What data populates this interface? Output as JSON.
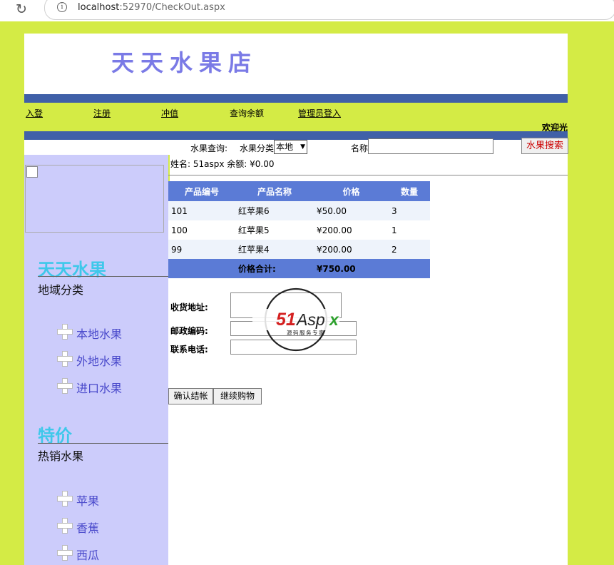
{
  "browser": {
    "url_host": "localhost",
    "url_rest": ":52970/CheckOut.aspx"
  },
  "header": {
    "shop_title": "天天水果店"
  },
  "nav": {
    "login": "入登",
    "register": "注册",
    "recharge": "冲值",
    "balance_query": "查询余额",
    "admin_login": "管理员登入",
    "welcome": "欢迎光"
  },
  "search": {
    "query_label": "水果查询:",
    "category_label": "水果分类",
    "category_value": "本地",
    "name_label": "名称",
    "button": "水果搜索"
  },
  "customer": {
    "info": "姓名: 51aspx     余额: ¥0.00"
  },
  "cart": {
    "headers": [
      "产品编号",
      "产品名称",
      "价格",
      "数量"
    ],
    "rows": [
      {
        "id": "101",
        "name": "红苹果6",
        "price": "¥50.00",
        "qty": "3"
      },
      {
        "id": "100",
        "name": "红苹果5",
        "price": "¥200.00",
        "qty": "1"
      },
      {
        "id": "99",
        "name": "红苹果4",
        "price": "¥200.00",
        "qty": "2"
      }
    ],
    "total_label": "价格合计:",
    "total_value": "¥750.00"
  },
  "form": {
    "address_label": "收货地址:",
    "zip_label": "邮政编码:",
    "phone_label": "联系电话:",
    "confirm_button": "确认结帐",
    "continue_button": "继续购物"
  },
  "sidebar": {
    "section1": {
      "title": "天天水果",
      "subtitle": "地域分类",
      "items": [
        "本地水果",
        "外地水果",
        "进口水果"
      ]
    },
    "section2": {
      "title": "特价",
      "subtitle": "热销水果",
      "items": [
        "苹果",
        "香蕉",
        "西瓜"
      ]
    }
  },
  "watermark": {
    "brand": "51Aspx",
    "tagline": "源码服务专家"
  },
  "colors": {
    "page_bg": "#d4eb45",
    "band": "#4060a8",
    "sidebar_bg": "#ccccfb",
    "table_header": "#5b7bd6",
    "title": "#7a7ae6"
  }
}
